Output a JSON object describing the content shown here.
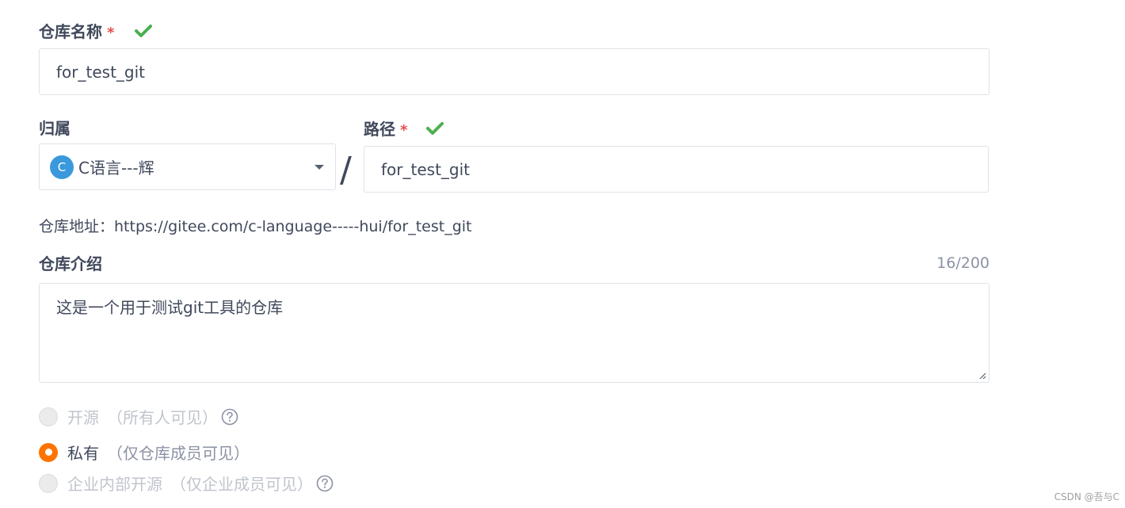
{
  "form": {
    "repo_name": {
      "label": "仓库名称",
      "required_mark": "*",
      "value": "for_test_git"
    },
    "owner": {
      "label": "归属",
      "avatar_letter": "C",
      "value": "C语言---辉"
    },
    "path": {
      "label": "路径",
      "required_mark": "*",
      "value": "for_test_git"
    },
    "separator": "/",
    "address": {
      "text": "仓库地址：https://gitee.com/c-language-----hui/for_test_git"
    },
    "description": {
      "label": "仓库介绍",
      "counter": "16/200",
      "value": "这是一个用于测试git工具的仓库"
    },
    "visibility": {
      "options": [
        {
          "label": "开源",
          "desc": "（所有人可见）",
          "state": "disabled",
          "has_help": true
        },
        {
          "label": "私有",
          "desc": "（仅仓库成员可见）",
          "state": "checked",
          "has_help": false
        },
        {
          "label": "企业内部开源",
          "desc": "（仅企业成员可见）",
          "state": "disabled",
          "has_help": true
        }
      ]
    }
  },
  "watermark": "CSDN @吾与C",
  "colors": {
    "check": "#4caf50",
    "required": "#e34f4f",
    "radio_checked": "#fe7300",
    "avatar": "#3a99dc"
  },
  "icons": {
    "valid": "check-icon",
    "dropdown": "chevron-down-icon",
    "help": "question-circle-icon"
  }
}
